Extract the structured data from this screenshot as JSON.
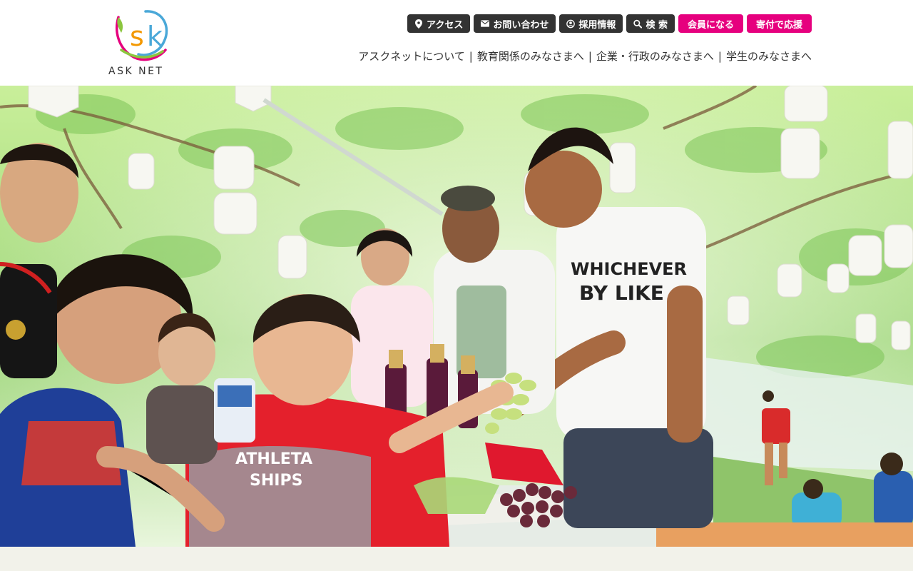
{
  "logo": {
    "text": "ASK NET",
    "mark": "sk"
  },
  "top_buttons": [
    {
      "label": "アクセス",
      "icon": "map-pin-icon",
      "style": "dark"
    },
    {
      "label": "お問い合わせ",
      "icon": "envelope-icon",
      "style": "dark"
    },
    {
      "label": "採用情報",
      "icon": "user-circle-icon",
      "style": "dark"
    },
    {
      "label": "検 索",
      "icon": "search-icon",
      "style": "dark"
    },
    {
      "label": "会員になる",
      "icon": "",
      "style": "pink"
    },
    {
      "label": "寄付で応援",
      "icon": "",
      "style": "pink"
    }
  ],
  "nav": [
    {
      "label": "アスクネットについて"
    },
    {
      "label": "教育関係のみなさまへ"
    },
    {
      "label": "企業・行政のみなさまへ"
    },
    {
      "label": "学生のみなさまへ"
    }
  ],
  "nav_separator": "|",
  "hero": {
    "shirt_text_1": "ATHLETA",
    "shirt_text_2": "SHIPS",
    "tee_text_1": "WHICHEVER",
    "tee_text_2": "BY LIKE"
  },
  "colors": {
    "dark_button": "#333333",
    "pink_button": "#e6007e",
    "foliage": "#8fd06a",
    "background": "#f3f3ec"
  }
}
